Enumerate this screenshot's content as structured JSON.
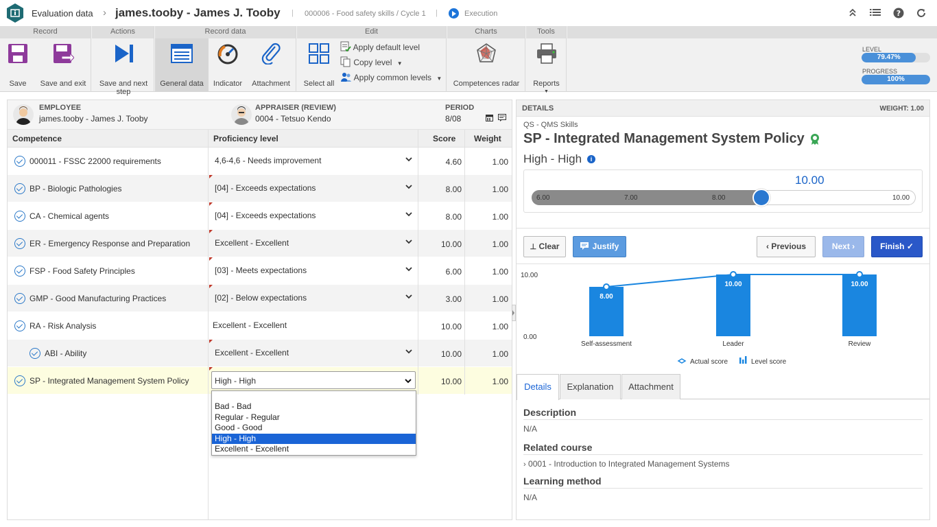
{
  "topbar": {
    "breadcrumb_root": "Evaluation data",
    "title": "james.tooby - James J. Tooby",
    "context": "000006 - Food safety skills / Cycle 1",
    "status": "Execution"
  },
  "ribbon": {
    "groups": {
      "record": "Record",
      "actions": "Actions",
      "record_data": "Record data",
      "edit": "Edit",
      "charts": "Charts",
      "tools": "Tools"
    },
    "buttons": {
      "save": "Save",
      "save_exit": "Save and exit",
      "save_next_1": "Save and next",
      "save_next_2": "step",
      "general_data": "General data",
      "indicator": "Indicator",
      "attachment": "Attachment",
      "select_all": "Select all",
      "apply_default": "Apply default level",
      "copy_level": "Copy level",
      "apply_common": "Apply common levels",
      "competences_radar": "Competences radar",
      "reports": "Reports"
    },
    "level_label": "LEVEL",
    "level_value": "79.47%",
    "level_pct": 79.47,
    "progress_label": "PROGRESS",
    "progress_value": "100%",
    "progress_pct": 100
  },
  "left": {
    "employee_label": "EMPLOYEE",
    "employee_value": "james.tooby - James J. Tooby",
    "appraiser_label": "APPRAISER (REVIEW)",
    "appraiser_value": "0004 - Tetsuo Kendo",
    "period_label": "PERIOD",
    "period_value": "8/08",
    "columns": {
      "competence": "Competence",
      "proficiency": "Proficiency level",
      "score": "Score",
      "weight": "Weight"
    },
    "rows": [
      {
        "name": "000011 - FSSC 22000 requirements",
        "level": "4,6-4,6 - Needs improvement",
        "score": "4.60",
        "weight": "1.00"
      },
      {
        "name": "BP - Biologic Pathologies",
        "level": "[04] - Exceeds expectations",
        "score": "8.00",
        "weight": "1.00"
      },
      {
        "name": "CA - Chemical agents",
        "level": "[04] - Exceeds expectations",
        "score": "8.00",
        "weight": "1.00"
      },
      {
        "name": "ER - Emergency Response and Preparation",
        "level": "Excellent - Excellent",
        "score": "10.00",
        "weight": "1.00"
      },
      {
        "name": "FSP - Food Safety Principles",
        "level": "[03] - Meets expectations",
        "score": "6.00",
        "weight": "1.00"
      },
      {
        "name": "GMP - Good Manufacturing Practices",
        "level": "[02] - Below expectations",
        "score": "3.00",
        "weight": "1.00"
      },
      {
        "name": "RA - Risk Analysis",
        "level": "Excellent - Excellent",
        "score": "10.00",
        "weight": "1.00"
      },
      {
        "name": "ABI - Ability",
        "level": "Excellent - Excellent",
        "score": "10.00",
        "weight": "1.00"
      },
      {
        "name": "SP - Integrated Management System Policy",
        "level": "High - High",
        "score": "10.00",
        "weight": "1.00"
      }
    ],
    "dropdown_options": [
      "Bad - Bad",
      "Regular - Regular",
      "Good - Good",
      "High - High",
      "Excellent - Excellent"
    ],
    "dropdown_selected": "High - High"
  },
  "right": {
    "header": "DETAILS",
    "weight": "WEIGHT: 1.00",
    "category": "QS - QMS Skills",
    "title": "SP - Integrated Management System Policy",
    "level": "High - High",
    "slider_value": "10.00",
    "slider_ticks": [
      "6.00",
      "7.00",
      "8.00",
      "10.00"
    ],
    "slider_level_pct": 0.8,
    "btn_clear": "Clear",
    "btn_justify": "Justify",
    "btn_previous": "Previous",
    "btn_next": "Next",
    "btn_finish": "Finish",
    "legend_actual": "Actual score",
    "legend_level": "Level score",
    "tabs": [
      "Details",
      "Explanation",
      "Attachment"
    ],
    "description_label": "Description",
    "description_value": "N/A",
    "course_label": "Related course",
    "course_value": "0001 - Introduction to Integrated Management Systems",
    "method_label": "Learning method",
    "method_value": "N/A"
  },
  "chart_data": {
    "type": "bar",
    "categories": [
      "Self-assessment",
      "Leader",
      "Review"
    ],
    "series": [
      {
        "name": "Level score",
        "values": [
          8.0,
          10.0,
          10.0
        ]
      },
      {
        "name": "Actual score",
        "values": [
          8.0,
          10.0,
          10.0
        ]
      }
    ],
    "data_labels": [
      "8.00",
      "10.00",
      "10.00"
    ],
    "ytick_labels": [
      "10.00",
      "0.00"
    ],
    "ylim": [
      0,
      10
    ],
    "colors": {
      "bar": "#1a86e0",
      "line": "#1a86e0"
    },
    "legend_position": "bottom"
  }
}
